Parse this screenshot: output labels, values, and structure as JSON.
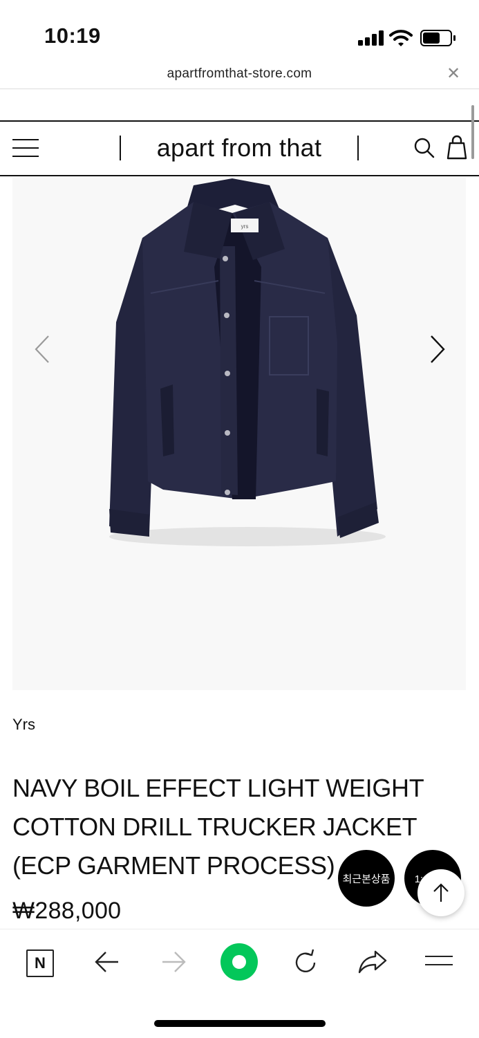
{
  "status_bar": {
    "time": "10:19"
  },
  "browser": {
    "url": "apartfromthat-store.com"
  },
  "header": {
    "logo": "apart from that"
  },
  "product": {
    "brand": "Yrs",
    "title": "NAVY BOIL EFFECT LIGHT WEIGHT COTTON DRILL TRUCKER JACKET (ECP GARMENT PROCESS)",
    "price": "₩288,000",
    "garment_label": "yrs"
  },
  "floating": {
    "recent_label": "최근본상품",
    "chat_label": "1:1 문의"
  },
  "icons": {
    "status": [
      "cellular-signal-icon",
      "wifi-icon",
      "battery-icon"
    ],
    "header": [
      "hamburger-menu-icon",
      "search-icon",
      "shopping-bag-icon"
    ],
    "bottom_nav": [
      "naver-n-icon",
      "back-arrow-icon",
      "forward-arrow-icon",
      "green-dot-icon",
      "reload-icon",
      "share-icon",
      "menu-icon"
    ]
  },
  "colors": {
    "jacket_navy": "#23253f",
    "green_button": "#03c75a",
    "fab_black": "#000000"
  }
}
